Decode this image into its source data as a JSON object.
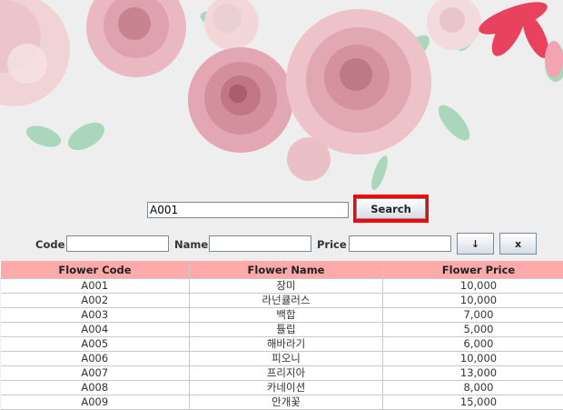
{
  "search": {
    "value": "A001",
    "button_label": "Search"
  },
  "form": {
    "code_label": "Code",
    "name_label": "Name",
    "price_label": "Price",
    "code_value": "",
    "name_value": "",
    "price_value": "",
    "add_button_label": "↓",
    "clear_button_label": "x"
  },
  "table": {
    "columns": [
      "Flower Code",
      "Flower Name",
      "Flower Price"
    ],
    "rows": [
      {
        "code": "A001",
        "name": "장미",
        "price": "10,000"
      },
      {
        "code": "A002",
        "name": "라넌큘러스",
        "price": "10,000"
      },
      {
        "code": "A003",
        "name": "백합",
        "price": "7,000"
      },
      {
        "code": "A004",
        "name": "튤립",
        "price": "5,000"
      },
      {
        "code": "A005",
        "name": "해바라기",
        "price": "6,000"
      },
      {
        "code": "A006",
        "name": "피오니",
        "price": "10,000"
      },
      {
        "code": "A007",
        "name": "프리지아",
        "price": "13,000"
      },
      {
        "code": "A008",
        "name": "카네이션",
        "price": "8,000"
      },
      {
        "code": "A009",
        "name": "안개꽃",
        "price": "15,000"
      }
    ]
  },
  "colors": {
    "header_bg": "#ffaaaa",
    "highlight_border": "#ff0000",
    "window_bg": "#eeeeee"
  }
}
